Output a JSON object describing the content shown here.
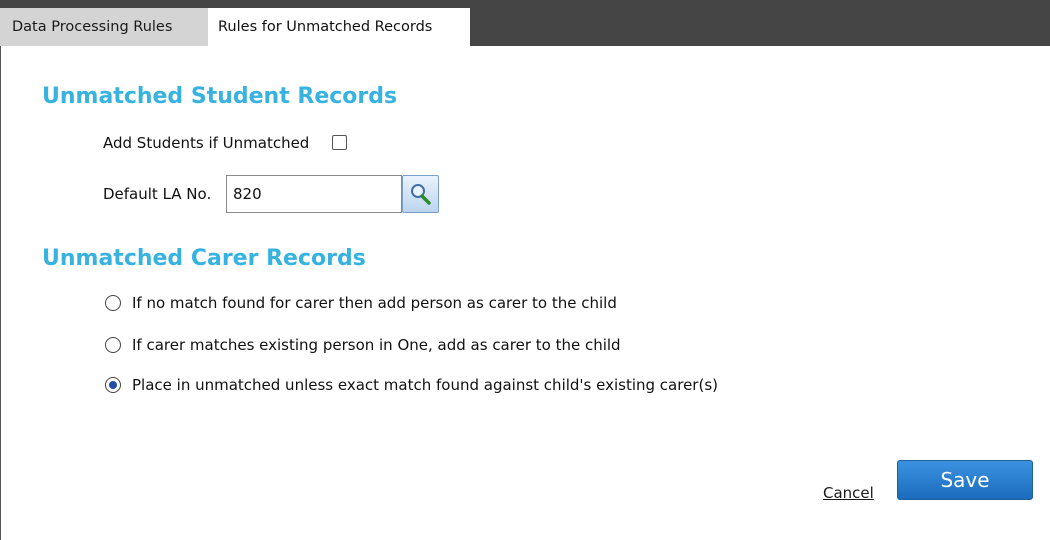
{
  "tabs": [
    {
      "label": "Data Processing Rules",
      "active": false
    },
    {
      "label": "Rules for Unmatched Records",
      "active": true
    }
  ],
  "student_section": {
    "title": "Unmatched Student Records",
    "add_students_label": "Add Students if Unmatched",
    "add_students_checked": false,
    "default_la_label": "Default LA No.",
    "default_la_value": "820",
    "lookup_icon": "search-icon"
  },
  "carer_section": {
    "title": "Unmatched Carer Records",
    "options": [
      {
        "label": "If no match found for carer then add person as carer to the child",
        "selected": false
      },
      {
        "label": "If carer matches existing person in One, add as carer to the child",
        "selected": false
      },
      {
        "label": "Place in unmatched unless exact match found against child's existing carer(s)",
        "selected": true
      }
    ]
  },
  "actions": {
    "cancel_label": "Cancel",
    "save_label": "Save"
  },
  "colors": {
    "accent": "#38b3e0",
    "tab_bar": "#454545",
    "save_button": "#2a7fd0"
  }
}
